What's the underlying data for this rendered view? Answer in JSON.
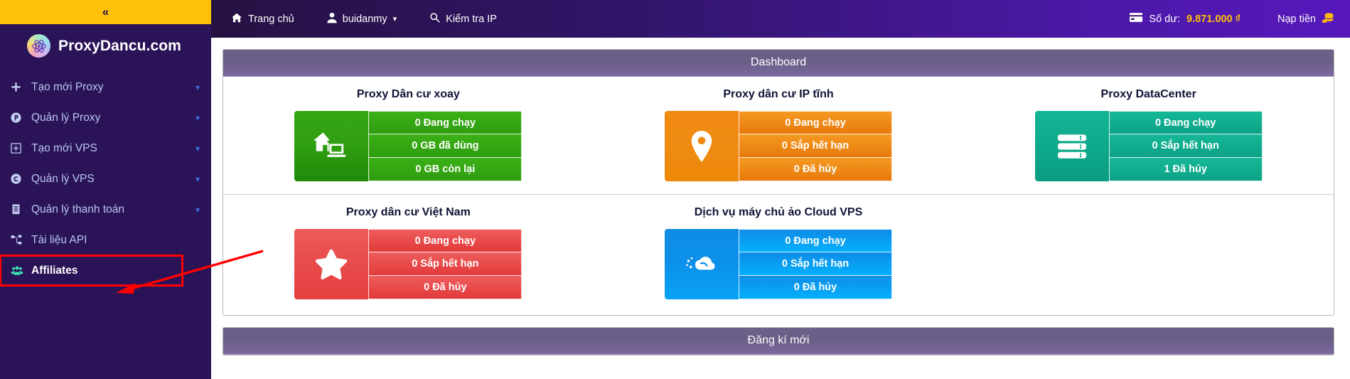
{
  "sidebar": {
    "collapse_label": "«",
    "brand": "ProxyDancu.com",
    "items": [
      {
        "label": "Tạo mới Proxy",
        "icon": "plus-icon",
        "caret": "▾"
      },
      {
        "label": "Quản lý Proxy",
        "icon": "proxy-circle-icon",
        "caret": "▾"
      },
      {
        "label": "Tạo mới VPS",
        "icon": "plus-square-icon",
        "caret": "▾"
      },
      {
        "label": "Quản lý VPS",
        "icon": "cpanel-circle-icon",
        "caret": "▾"
      },
      {
        "label": "Quản lý thanh toán",
        "icon": "receipt-icon",
        "caret": "▾"
      },
      {
        "label": "Tài liệu API",
        "icon": "sitemap-icon",
        "caret": ""
      },
      {
        "label": "Affiliates",
        "icon": "users-icon",
        "caret": ""
      }
    ]
  },
  "navbar": {
    "home_label": "Trang chủ",
    "user_label": "buidanmy",
    "user_caret": "▾",
    "ip_check_label": "Kiểm tra IP",
    "balance_label": "Số dư:",
    "balance_amount": "9.871.000 ₫",
    "topup_label": "Nạp tiền"
  },
  "dashboard": {
    "title": "Dashboard",
    "rows": [
      [
        {
          "title": "Proxy Dân cư xoay",
          "theme": "c-green",
          "icon": "house-laptop-icon",
          "lines": [
            "0 Đang chạy",
            "0 GB đã dùng",
            "0 GB còn lại"
          ]
        },
        {
          "title": "Proxy dân cư IP tĩnh",
          "theme": "c-orange",
          "icon": "map-pin-icon",
          "lines": [
            "0 Đang chạy",
            "0 Sắp hết hạn",
            "0 Đã hủy"
          ]
        },
        {
          "title": "Proxy DataCenter",
          "theme": "c-teal",
          "icon": "server-icon",
          "lines": [
            "0 Đang chạy",
            "0 Sắp hết hạn",
            "1 Đã hủy"
          ]
        }
      ],
      [
        {
          "title": "Proxy dân cư Việt Nam",
          "theme": "c-red",
          "icon": "star-icon",
          "lines": [
            "0 Đang chạy",
            "0 Sắp hết hạn",
            "0 Đã hủy"
          ]
        },
        {
          "title": "Dịch vụ máy chủ ảo Cloud VPS",
          "theme": "c-blue",
          "icon": "cloud-icon",
          "lines": [
            "0 Đang chạy",
            "0 Sắp hết hạn",
            "0 Đã hủy"
          ]
        },
        {
          "title": "",
          "theme": "",
          "icon": "",
          "lines": [],
          "empty": true
        }
      ]
    ]
  },
  "register_panel": {
    "title": "Đăng kí mới"
  },
  "colors": {
    "sidebar_bg": "#2a1457",
    "collapse_bar": "#ffc107",
    "navbar_start": "#261142",
    "navbar_end": "#5618bb",
    "balance_amount": "#ffc107",
    "panel_head": "#6d6189",
    "annotation": "#ff0000",
    "affiliate_icon": "#3ce6b0"
  }
}
